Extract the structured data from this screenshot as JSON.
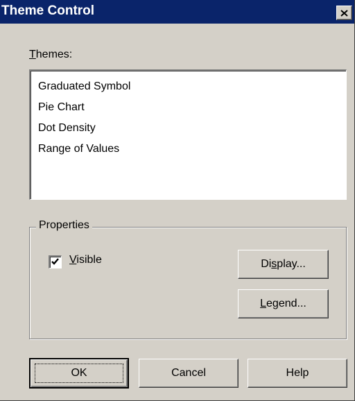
{
  "window": {
    "title": "Theme Control",
    "close_icon": "close-icon"
  },
  "themes": {
    "label_mnemonic": "T",
    "label_rest": "hemes:",
    "items": [
      "Graduated Symbol",
      "Pie Chart",
      "Dot Density",
      "Range of Values"
    ]
  },
  "properties": {
    "group_label": "Properties",
    "visible": {
      "checked": true,
      "label_mnemonic": "V",
      "label_rest": "isible"
    },
    "display_button": {
      "pre": "Di",
      "mnemonic": "s",
      "post": "play..."
    },
    "legend_button": {
      "pre": "",
      "mnemonic": "L",
      "post": "egend..."
    }
  },
  "buttons": {
    "ok": "OK",
    "cancel": "Cancel",
    "help": "Help"
  },
  "colors": {
    "titlebar": "#0a246a",
    "face": "#d4d0c8",
    "list_background": "#ffffff"
  }
}
